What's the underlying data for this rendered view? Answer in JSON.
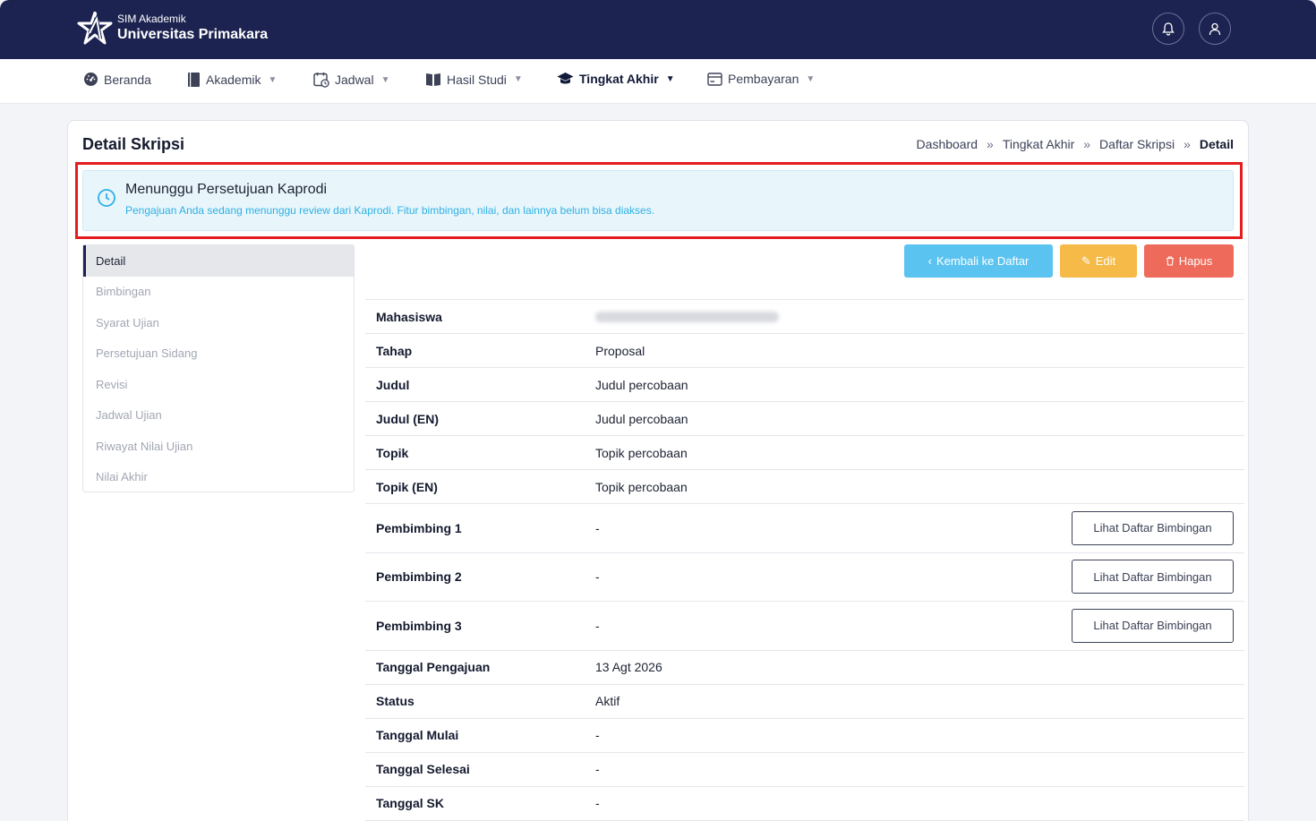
{
  "header": {
    "app_subtitle": "SIM Akademik",
    "university": "Universitas Primakara",
    "icons": [
      "bell-icon",
      "user-icon"
    ]
  },
  "nav": {
    "items": [
      {
        "label": "Beranda",
        "icon": "dashboard-icon"
      },
      {
        "label": "Akademik",
        "icon": "book-icon"
      },
      {
        "label": "Jadwal",
        "icon": "calendar-icon"
      },
      {
        "label": "Hasil Studi",
        "icon": "open-book-icon"
      },
      {
        "label": "Tingkat Akhir",
        "icon": "graduation-cap-icon"
      },
      {
        "label": "Pembayaran",
        "icon": "payment-icon"
      }
    ],
    "active": "Tingkat Akhir"
  },
  "page": {
    "title": "Detail Skripsi",
    "breadcrumb": [
      "Dashboard",
      "Tingkat Akhir",
      "Daftar Skripsi",
      "Detail"
    ],
    "breadcrumb_separator": "»"
  },
  "alert": {
    "title": "Menunggu Persetujuan Kaprodi",
    "text": "Pengajuan Anda sedang menunggu review dari Kaprodi. Fitur bimbingan, nilai, dan lainnya belum bisa diakses.",
    "icon": "clock-icon",
    "highlight_color": "#e41e1e"
  },
  "sidenav": {
    "items": [
      "Detail",
      "Bimbingan",
      "Syarat Ujian",
      "Persetujuan Sidang",
      "Revisi",
      "Jadwal Ujian",
      "Riwayat Nilai Ujian",
      "Nilai Akhir"
    ],
    "active": "Detail"
  },
  "actions": {
    "back_label": "Kembali ke Daftar",
    "edit_label": "Edit",
    "delete_label": "Hapus",
    "colors": {
      "back": "#5bc3f0",
      "edit": "#f5ba48",
      "delete": "#ee6a5a"
    }
  },
  "details": {
    "rows": [
      {
        "label": "Mahasiswa",
        "value": ""
      },
      {
        "label": "Tahap",
        "value": "Proposal"
      },
      {
        "label": "Judul",
        "value": "Judul percobaan"
      },
      {
        "label": "Judul (EN)",
        "value": "Judul percobaan"
      },
      {
        "label": "Topik",
        "value": "Topik percobaan"
      },
      {
        "label": "Topik (EN)",
        "value": "Topik percobaan"
      },
      {
        "label": "Pembimbing 1",
        "value": "-",
        "button": "Lihat Daftar Bimbingan"
      },
      {
        "label": "Pembimbing 2",
        "value": "-",
        "button": "Lihat Daftar Bimbingan"
      },
      {
        "label": "Pembimbing 3",
        "value": "-",
        "button": "Lihat Daftar Bimbingan"
      },
      {
        "label": "Tanggal Pengajuan",
        "value": "13 Agt 2026"
      },
      {
        "label": "Status",
        "value": "Aktif"
      },
      {
        "label": "Tanggal Mulai",
        "value": "-"
      },
      {
        "label": "Tanggal Selesai",
        "value": "-"
      },
      {
        "label": "Tanggal SK",
        "value": "-"
      }
    ]
  }
}
